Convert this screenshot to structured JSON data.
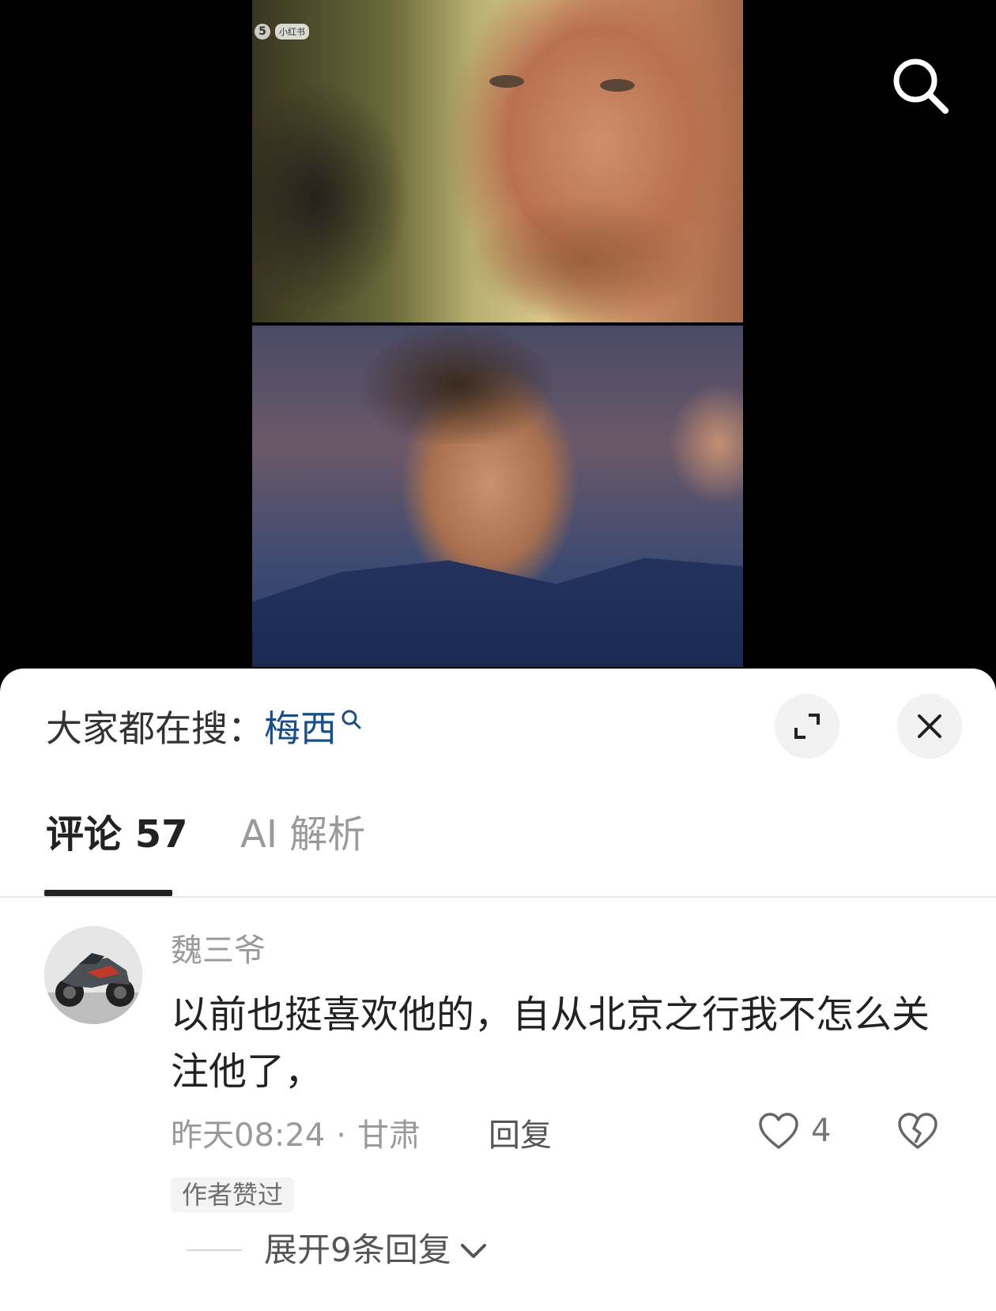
{
  "media": {
    "watermark_number": "5",
    "watermark_badge": "小红书"
  },
  "search_bar": {
    "prefix": "大家都在搜：",
    "term": "梅西"
  },
  "tabs": [
    {
      "label": "评论 57",
      "active": true
    },
    {
      "label": "AI 解析",
      "active": false
    }
  ],
  "comment": {
    "username": "魏三爷",
    "text": "以前也挺喜欢他的，自从北京之行我不怎么关注他了，",
    "time": "昨天08:24",
    "separator": "·",
    "location": "甘肃",
    "reply_label": "回复",
    "like_count": "4",
    "author_badge": "作者赞过",
    "expand_replies": "展开9条回复"
  },
  "colors": {
    "accent_link": "#1c4e86",
    "sheet_bg": "#ffffff",
    "muted_text": "#9a9a9a"
  },
  "icons": {
    "search": "search-icon",
    "expand": "expand-icon",
    "close": "close-icon",
    "like": "heart-icon",
    "dislike": "broken-heart-icon",
    "chevron": "chevron-down-icon"
  }
}
